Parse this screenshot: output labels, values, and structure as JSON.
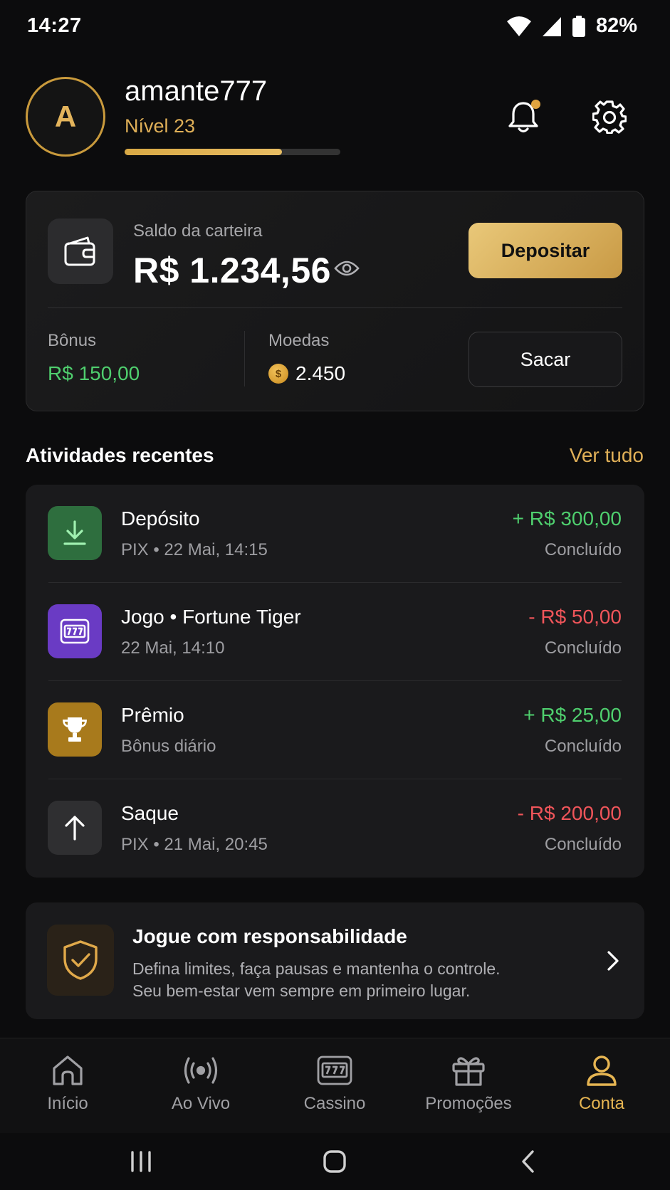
{
  "status_bar": {
    "time": "14:27",
    "battery": "82%"
  },
  "profile": {
    "avatar_letter": "A",
    "username": "amante777",
    "level": "Nível 23",
    "xp_progress": 0.73
  },
  "wallet": {
    "label": "Saldo da carteira",
    "balance": "R$ 1.234,56",
    "deposit_label": "Depositar",
    "bonus_label": "Bônus",
    "bonus_value": "R$ 150,00",
    "coins_label": "Moedas",
    "coins_value": "2.450",
    "withdraw_label": "Sacar"
  },
  "activity": {
    "title": "Atividades recentes",
    "see_all": "Ver tudo",
    "items": [
      {
        "title": "Depósito",
        "subtitle": "PIX • 22 Mai, 14:15",
        "amount": "+ R$ 300,00",
        "status": "Concluído",
        "icon": "download-icon",
        "color": "#2e6e3e"
      },
      {
        "title": "Jogo • Fortune Tiger",
        "subtitle": "22 Mai, 14:10",
        "amount": "- R$ 50,00",
        "status": "Concluído",
        "icon": "slot-machine-icon",
        "color": "#6a3bc4"
      },
      {
        "title": "Prêmio",
        "subtitle": "Bônus diário",
        "amount": "+ R$ 25,00",
        "status": "Concluído",
        "icon": "trophy-icon",
        "color": "#a87a1c"
      },
      {
        "title": "Saque",
        "subtitle": "PIX • 21 Mai, 20:45",
        "amount": "- R$ 200,00",
        "status": "Concluído",
        "icon": "arrow-up-icon",
        "color": "#2f2f31"
      }
    ]
  },
  "responsible": {
    "title": "Jogue com responsabilidade",
    "line1": "Defina limites, faça pausas e mantenha o controle.",
    "line2": "Seu bem-estar vem sempre em primeiro lugar."
  },
  "nav": {
    "items": [
      {
        "label": "Início",
        "icon": "home-icon"
      },
      {
        "label": "Ao Vivo",
        "icon": "live-icon"
      },
      {
        "label": "Cassino",
        "icon": "slot-machine-icon"
      },
      {
        "label": "Promoções",
        "icon": "gift-icon"
      },
      {
        "label": "Conta",
        "icon": "user-icon",
        "active": true
      }
    ]
  },
  "colors": {
    "accent": "#e0b058",
    "positive": "#4fcf6e",
    "negative": "#f0555a"
  }
}
